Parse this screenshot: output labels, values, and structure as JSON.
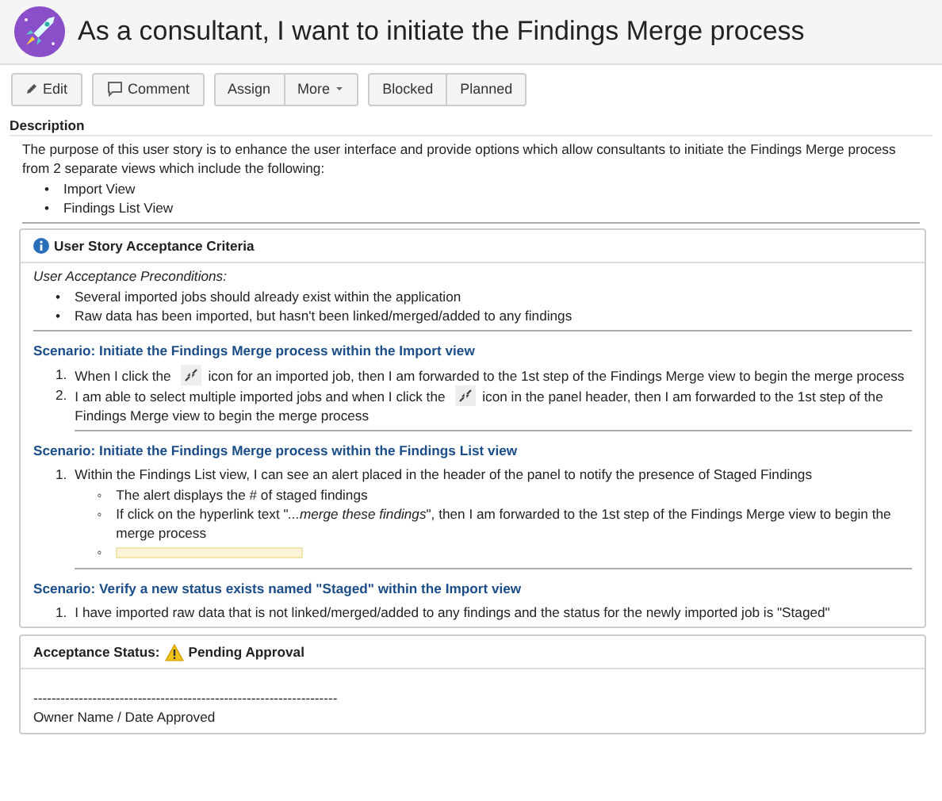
{
  "title": "As a consultant, I want to initiate the Findings Merge process",
  "button_groups": [
    {
      "buttons": [
        {
          "label": "Edit",
          "kind": "edit"
        }
      ]
    },
    {
      "buttons": [
        {
          "label": "Comment",
          "kind": "comment"
        }
      ]
    },
    {
      "buttons": [
        {
          "label": "Assign",
          "kind": "plain"
        },
        {
          "label": "More",
          "kind": "dropdown"
        }
      ]
    },
    {
      "buttons": [
        {
          "label": "Blocked",
          "kind": "plain"
        },
        {
          "label": "Planned",
          "kind": "plain"
        }
      ]
    }
  ],
  "description": {
    "heading": "Description",
    "text": "The purpose of this user story is to enhance the user interface and provide options which allow consultants to initiate the Findings Merge process from 2 separate views which include the following:",
    "items": [
      {
        "marker": "•",
        "text": "Import View"
      },
      {
        "marker": "•",
        "text": "Findings List View"
      }
    ]
  },
  "criteria_panel": {
    "heading": "User Story Acceptance Criteria",
    "preconditions_label": "User Acceptance Preconditions:",
    "preconditions": [
      {
        "marker": "•",
        "text": "Several imported jobs should already exist within the application"
      },
      {
        "marker": "•",
        "text": "Raw data has been imported, but hasn't been linked/merged/added to any findings"
      }
    ],
    "scenarios": [
      {
        "title": "Scenario: Initiate the Findings Merge process within the Import view",
        "steps": [
          {
            "marker": "1.",
            "parts": [
              "When I click the ",
              "icon for an imported job, then I am forwarded to the 1st step of the Findings Merge view to begin the merge process"
            ]
          },
          {
            "marker": "2.",
            "parts": [
              "I am able to select multiple imported jobs and when I click the ",
              "icon in the panel header, then I am forwarded to the 1st step of the Findings Merge view to begin the merge process"
            ]
          }
        ]
      },
      {
        "title": "Scenario: Initiate the Findings Merge process within the Findings List view",
        "steps": [
          {
            "marker": "1.",
            "parts": [
              "Within the Findings List view, I can see an alert placed in the header of the panel to notify the presence of Staged Findings"
            ],
            "subitems": [
              {
                "kind": "text",
                "marker": "◦",
                "text": "The alert displays the # of staged findings"
              },
              {
                "kind": "text",
                "marker": "◦",
                "text": "If click on the hyperlink text \"*...merge these findings*\", then I am forwarded to the 1st step of the Findings Merge view to begin the merge process"
              },
              {
                "kind": "image",
                "marker": "◦"
              }
            ]
          }
        ]
      },
      {
        "title": "Scenario: Verify a new status exists named \"Staged\" within the Import view",
        "steps": [
          {
            "marker": "1.",
            "parts": [
              "I have imported raw data that is not linked/merged/added to any findings and the status for the newly imported job is \"Staged\""
            ]
          }
        ]
      }
    ]
  },
  "status_panel": {
    "label": "Acceptance Status:",
    "status": "Pending Approval",
    "signature_line": "-------------------------------------------------------------------",
    "signature_caption": "Owner Name / Date Approved"
  }
}
